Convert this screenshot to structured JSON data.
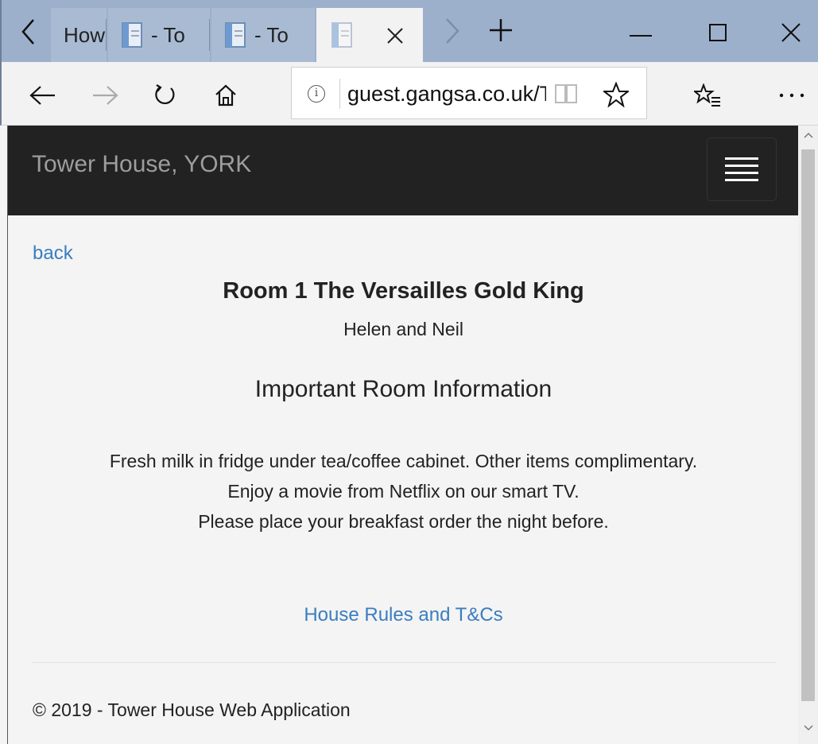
{
  "browser": {
    "tabs": [
      {
        "label": "How"
      },
      {
        "label": "- To"
      },
      {
        "label": "- To"
      },
      {
        "label": ""
      }
    ],
    "address_url": "guest.gangsa.co.uk/T",
    "info_glyph": "i"
  },
  "page": {
    "brand": "Tower House, YORK",
    "back_link": "back",
    "room_title": "Room 1 The Versailles Gold King",
    "guests": "Helen and Neil",
    "info_heading": "Important Room Information",
    "info_lines": [
      "Fresh milk in fridge under tea/coffee cabinet. Other items complimentary.",
      "Enjoy a movie from Netflix on our smart TV.",
      "Please place your breakfast order the night before."
    ],
    "rules_link": "House Rules and T&Cs",
    "footer": "© 2019 - Tower House Web Application"
  },
  "colors": {
    "tabstrip": "#9db0cb",
    "navbar": "#222222",
    "link": "#3a7dc0"
  }
}
